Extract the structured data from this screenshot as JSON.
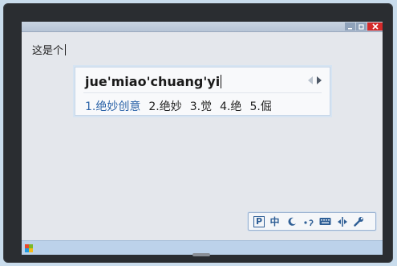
{
  "window": {
    "controls": {
      "minimize": "-",
      "maximize": "□",
      "close": "✕"
    }
  },
  "editor": {
    "text": "这是个"
  },
  "ime": {
    "composition": "jue'miao'chuang'yi",
    "candidates": [
      {
        "label": "1.绝妙创意",
        "active": true
      },
      {
        "label": "2.绝妙",
        "active": false
      },
      {
        "label": "3.觉",
        "active": false
      },
      {
        "label": "4.绝",
        "active": false
      },
      {
        "label": "5.倔",
        "active": false
      }
    ],
    "page_prev_icon": "chevron-left-icon",
    "page_next_icon": "chevron-right-icon"
  },
  "ime_toolbar": {
    "logo": "P",
    "mode_label": "中",
    "icons": [
      "logo-icon",
      "chinese-mode-icon",
      "moon-icon",
      "punctuation-icon",
      "keyboard-icon",
      "split-icon",
      "wrench-icon"
    ]
  },
  "taskbar": {
    "start_icon": "windows-logo-icon"
  },
  "colors": {
    "accent": "#2b63a8",
    "close": "#d42a2a",
    "bezel": "#2a2d31"
  }
}
